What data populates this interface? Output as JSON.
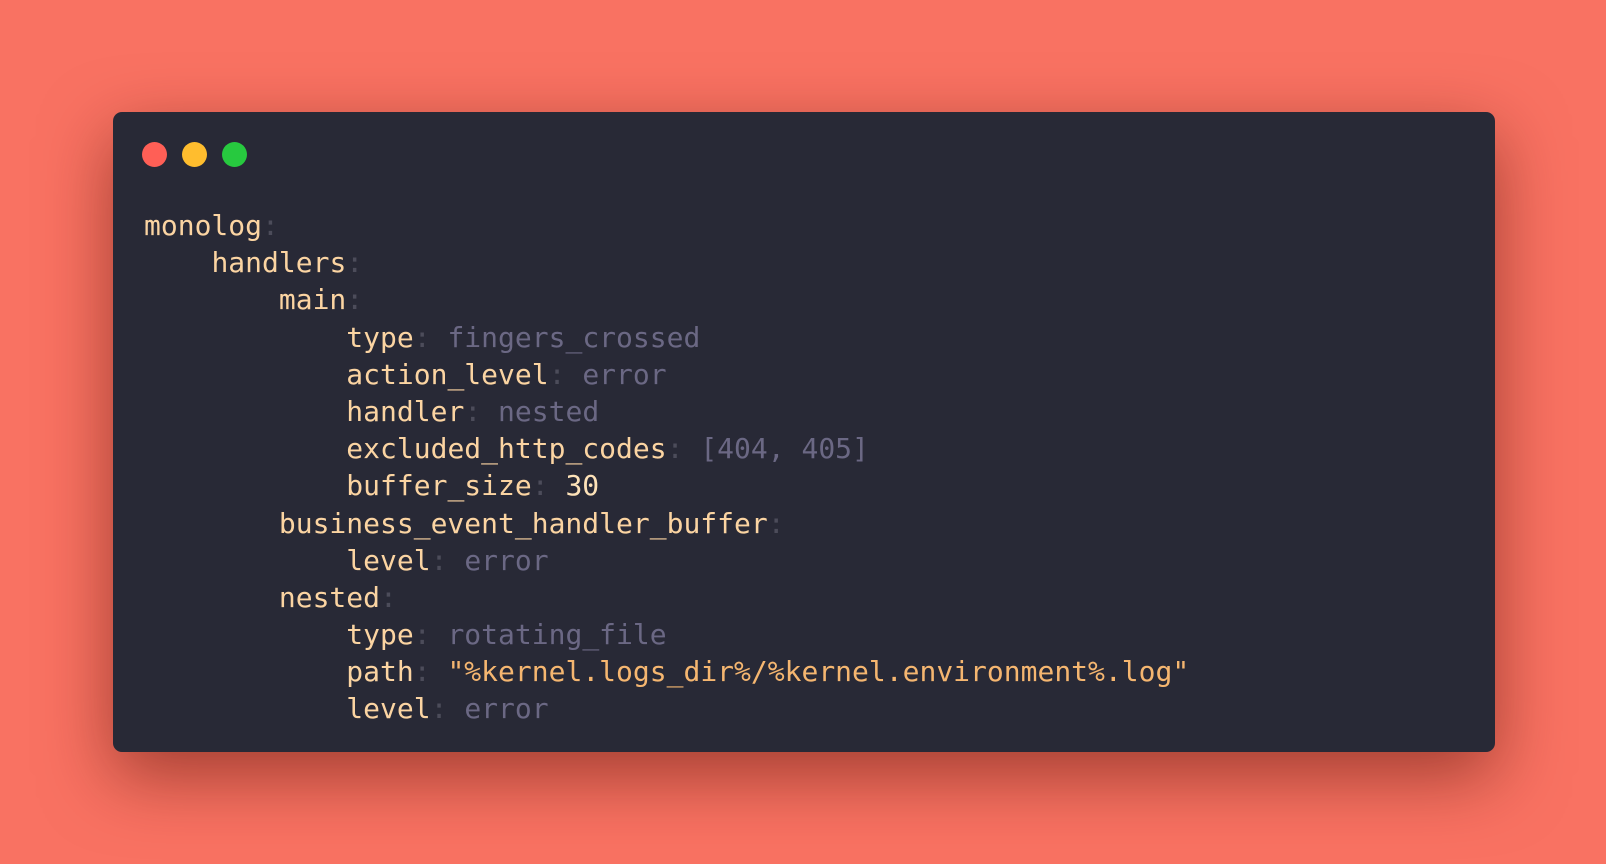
{
  "window_controls": {
    "close": "close",
    "minimize": "minimize",
    "maximize": "maximize",
    "colors": {
      "close": "#ff5f56",
      "minimize": "#ffbd2e",
      "maximize": "#27c93f"
    }
  },
  "code_lines": [
    {
      "indent": 0,
      "key": "monolog",
      "value": null,
      "kind": null
    },
    {
      "indent": 1,
      "key": "handlers",
      "value": null,
      "kind": null
    },
    {
      "indent": 2,
      "key": "main",
      "value": null,
      "kind": null
    },
    {
      "indent": 3,
      "key": "type",
      "value": "fingers_crossed",
      "kind": "v"
    },
    {
      "indent": 3,
      "key": "action_level",
      "value": "error",
      "kind": "v"
    },
    {
      "indent": 3,
      "key": "handler",
      "value": "nested",
      "kind": "v"
    },
    {
      "indent": 3,
      "key": "excluded_http_codes",
      "value": "[404, 405]",
      "kind": "v"
    },
    {
      "indent": 3,
      "key": "buffer_size",
      "value": "30",
      "kind": "n"
    },
    {
      "indent": 2,
      "key": "business_event_handler_buffer",
      "value": null,
      "kind": null
    },
    {
      "indent": 3,
      "key": "level",
      "value": "error",
      "kind": "v"
    },
    {
      "indent": 2,
      "key": "nested",
      "value": null,
      "kind": null
    },
    {
      "indent": 3,
      "key": "type",
      "value": "rotating_file",
      "kind": "v"
    },
    {
      "indent": 3,
      "key": "path",
      "value": "\"%kernel.logs_dir%/%kernel.environment%.log\"",
      "kind": "s"
    },
    {
      "indent": 3,
      "key": "level",
      "value": "error",
      "kind": "v"
    }
  ]
}
